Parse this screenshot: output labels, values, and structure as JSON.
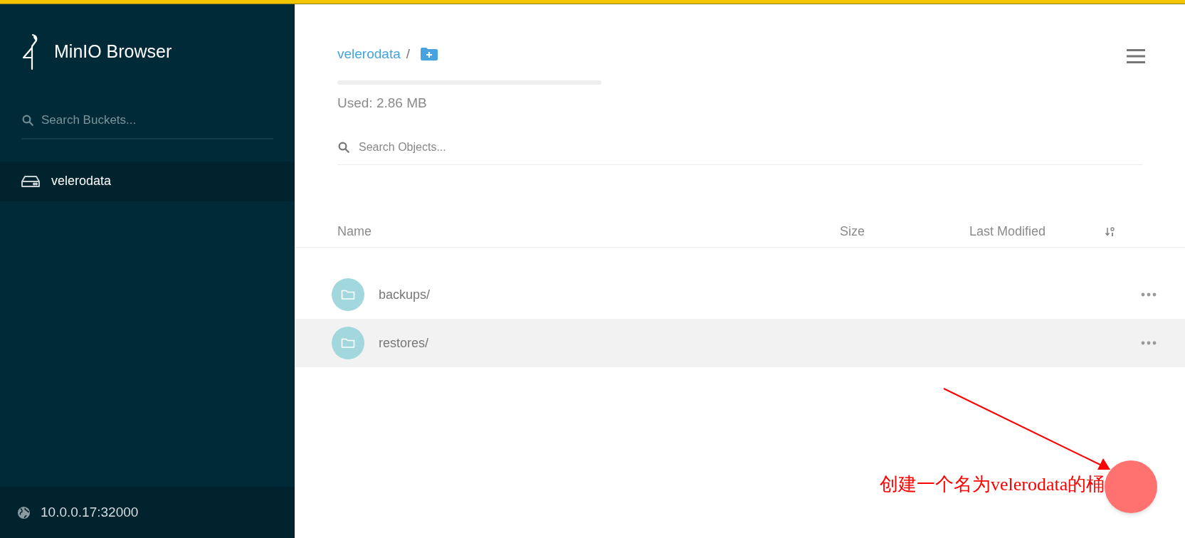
{
  "sidebar": {
    "title": "MinIO Browser",
    "search": {
      "placeholder": "Search Buckets..."
    },
    "buckets": [
      {
        "name": "velerodata",
        "selected": true
      }
    ],
    "host": "10.0.0.17:32000"
  },
  "main": {
    "breadcrumb": {
      "bucket": "velerodata",
      "separator": "/"
    },
    "usage": {
      "label": "Used: 2.86 MB"
    },
    "search": {
      "placeholder": "Search Objects..."
    },
    "table": {
      "columns": [
        "Name",
        "Size",
        "Last Modified"
      ],
      "rows": [
        {
          "name": "backups/",
          "hovered": false
        },
        {
          "name": "restores/",
          "hovered": true
        }
      ]
    }
  },
  "annotation": {
    "text": "创建一个名为velerodata的桶"
  }
}
